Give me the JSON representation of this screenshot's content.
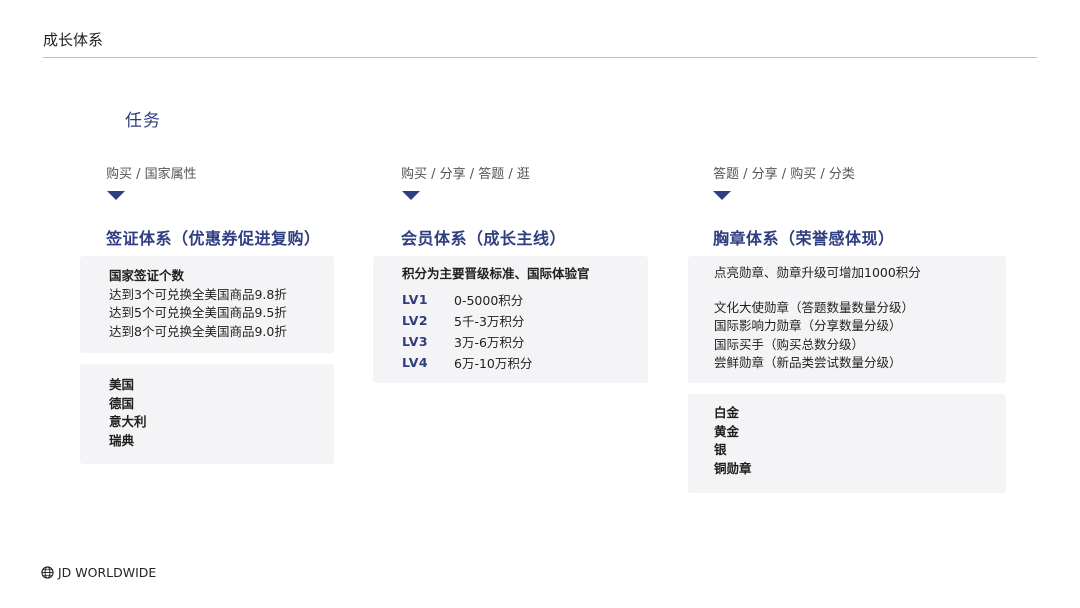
{
  "header": {
    "title": "成长体系"
  },
  "section_title": "任务",
  "columns": [
    {
      "tags": "购买 / 国家属性",
      "title": "签证体系（优惠券促进复购）",
      "card1": {
        "heading": "国家签证个数",
        "lines": [
          "达到3个可兑换全美国商品9.8折",
          "达到5个可兑换全美国商品9.5折",
          "达到8个可兑换全美国商品9.0折"
        ]
      },
      "card2": {
        "lines": [
          "美国",
          "德国",
          "意大利",
          "瑞典"
        ]
      }
    },
    {
      "tags": "购买 / 分享 / 答题 / 逛",
      "title": "会员体系（成长主线）",
      "card1": {
        "heading": "积分为主要晋级标准、国际体验官",
        "levels": [
          {
            "label": "LV1",
            "value": "0-5000积分"
          },
          {
            "label": "LV2",
            "value": "5千-3万积分"
          },
          {
            "label": "LV3",
            "value": "3万-6万积分"
          },
          {
            "label": "LV4",
            "value": "6万-10万积分"
          }
        ]
      }
    },
    {
      "tags": "答题 / 分享 / 购买 / 分类",
      "title": "胸章体系（荣誉感体现）",
      "card1": {
        "intro": "点亮勋章、勋章升级可增加1000积分",
        "lines": [
          "文化大使勋章（答题数量数量分级）",
          "国际影响力勋章（分享数量分级）",
          "国际买手（购买总数分级）",
          "尝鲜勋章（新品类尝试数量分级）"
        ]
      },
      "card2": {
        "lines": [
          "白金",
          "黄金",
          "银",
          "铜勋章"
        ]
      }
    }
  ],
  "footer": {
    "brand": "JD WORLDWIDE",
    "icon": "globe-icon"
  },
  "colors": {
    "accent": "#2f3e80",
    "card_bg": "#f4f4f6",
    "rule": "#bdbdbd"
  }
}
